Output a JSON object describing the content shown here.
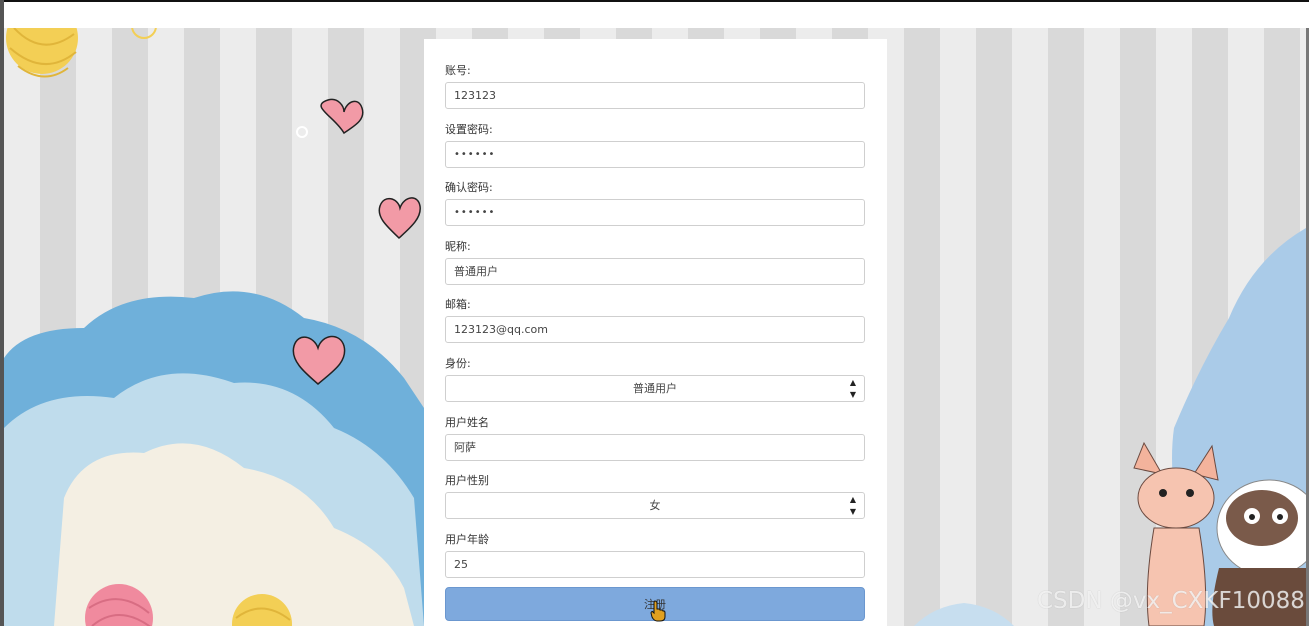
{
  "form": {
    "account": {
      "label": "账号:",
      "value": "123123"
    },
    "password": {
      "label": "设置密码:",
      "value": "••••••"
    },
    "confirm_password": {
      "label": "确认密码:",
      "value": "••••••"
    },
    "nickname": {
      "label": "昵称:",
      "value": "普通用户"
    },
    "email": {
      "label": "邮箱:",
      "value": "123123@qq.com"
    },
    "identity": {
      "label": "身份:",
      "value": "普通用户"
    },
    "real_name": {
      "label": "用户姓名",
      "value": "阿萨"
    },
    "gender": {
      "label": "用户性别",
      "value": "女"
    },
    "age": {
      "label": "用户年龄",
      "value": "25"
    },
    "submit_label": "注册"
  },
  "watermark": "CSDN @vx_CXKF10088",
  "colors": {
    "button": "#7ea9dd",
    "cloud_blue": "#6fb0da",
    "cloud_light": "#bfdcec",
    "cloud_cream": "#f4efe3",
    "heart": "#f29aa6",
    "yarn_yellow": "#f3cf55",
    "yarn_pink": "#f08a9e"
  }
}
